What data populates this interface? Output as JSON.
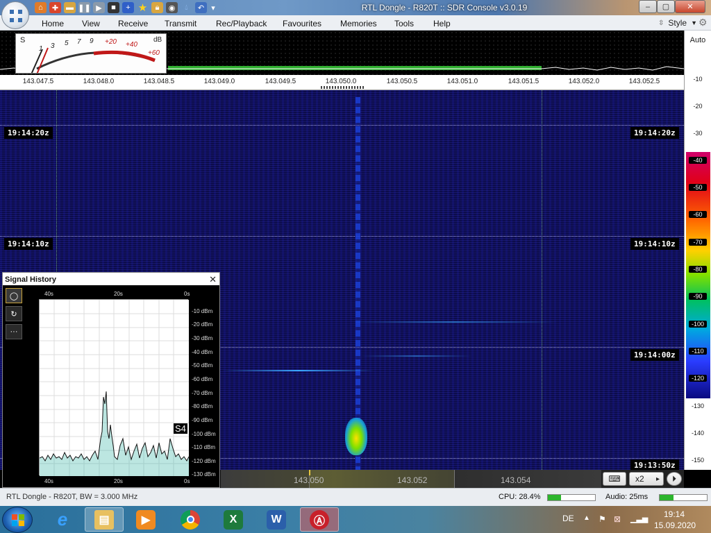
{
  "window": {
    "title": "RTL Dongle - R820T :: SDR Console v3.0.19",
    "minimize": "–",
    "maximize": "▢",
    "close": "✕"
  },
  "quick_access": [
    "home-icon",
    "lifebuoy-icon",
    "folder-icon",
    "pause-icon",
    "play-icon",
    "stop-icon",
    "add-icon",
    "star-icon",
    "lock-icon",
    "camera-icon",
    "drop-icon",
    "undo-icon",
    "dropdown-icon"
  ],
  "menu": {
    "items": [
      "Home",
      "View",
      "Receive",
      "Transmit",
      "Rec/Playback",
      "Favourites",
      "Memories",
      "Tools",
      "Help"
    ],
    "style_label": "Style",
    "style_arrow": "▼"
  },
  "smeter": {
    "s_label": "S",
    "db_label": "dB",
    "scale": [
      "1",
      "3",
      "5",
      "7",
      "9",
      "+20",
      "+40",
      "+60"
    ]
  },
  "frequency_axis": {
    "ticks": [
      "143.047.5",
      "143.048.0",
      "143.048.5",
      "143.049.0",
      "143.049.5",
      "143.050.0",
      "143.050.5",
      "143.051.0",
      "143.051.5",
      "143.052.0",
      "143.052.5"
    ]
  },
  "waterfall": {
    "timestamps": [
      "19:14:20z",
      "19:14:10z",
      "19:14:00z",
      "19:13:50z"
    ]
  },
  "db_scale": {
    "mode": "Auto",
    "labels": [
      "-10",
      "-20",
      "-30",
      "-40",
      "-50",
      "-60",
      "-70",
      "-80",
      "-90",
      "-100",
      "-110",
      "-120",
      "-130",
      "-140",
      "-150"
    ]
  },
  "bottom_strip": {
    "ticks": [
      "143.050",
      "143.052",
      "143.054"
    ],
    "zoom": "x2",
    "next": "▸",
    "keyboard_icon": "keyboard-icon",
    "playback_icon": "playback-icon"
  },
  "signal_history": {
    "title": "Signal History",
    "close": "✕",
    "top_x_labels": [
      "40s",
      "20s",
      "0s"
    ],
    "bottom_x_labels": [
      "40s",
      "20s",
      "0s"
    ],
    "y_labels": [
      "-10 dBm",
      "-20 dBm",
      "-30 dBm",
      "-40 dBm",
      "-50 dBm",
      "-60 dBm",
      "-70 dBm",
      "-80 dBm",
      "-90 dBm",
      "-100 dBm",
      "-110 dBm",
      "-120 dBm",
      "-130 dBm"
    ],
    "s_indicator": "S4",
    "tools": [
      "record-icon",
      "reset-icon",
      "more-icon"
    ],
    "more_label": "···"
  },
  "status": {
    "left": "RTL Dongle - R820T, BW = 3.000 MHz",
    "cpu": "CPU: 28.4%",
    "cpu_fraction": 0.284,
    "audio": "Audio: 25ms",
    "audio_fraction": 0.3
  },
  "taskbar": {
    "apps": [
      "ie-icon",
      "explorer-icon",
      "media-player-icon",
      "chrome-icon",
      "excel-icon",
      "word-icon",
      "sdr-console-icon"
    ],
    "language": "DE",
    "time": "19:14",
    "date": "15.09.2020"
  }
}
